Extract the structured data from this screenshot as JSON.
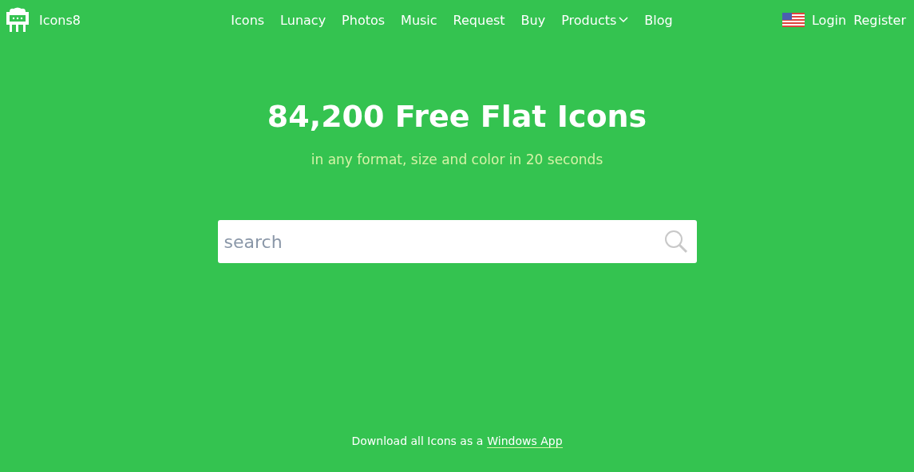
{
  "brand": {
    "name": "Icons8"
  },
  "nav": [
    {
      "label": "Icons",
      "kind": "link"
    },
    {
      "label": "Lunacy",
      "kind": "link"
    },
    {
      "label": "Photos",
      "kind": "link"
    },
    {
      "label": "Music",
      "kind": "link"
    },
    {
      "label": "Request",
      "kind": "link"
    },
    {
      "label": "Buy",
      "kind": "link"
    },
    {
      "label": "Products",
      "kind": "dropdown"
    },
    {
      "label": "Blog",
      "kind": "link"
    }
  ],
  "account": {
    "login": "Login",
    "register": "Register"
  },
  "hero": {
    "title": "84,200 Free Flat Icons",
    "subtitle": "in any format, size and color in 20 seconds"
  },
  "search": {
    "placeholder": "search"
  },
  "footer": {
    "text": "Download all Icons as a",
    "link": "Windows App"
  }
}
